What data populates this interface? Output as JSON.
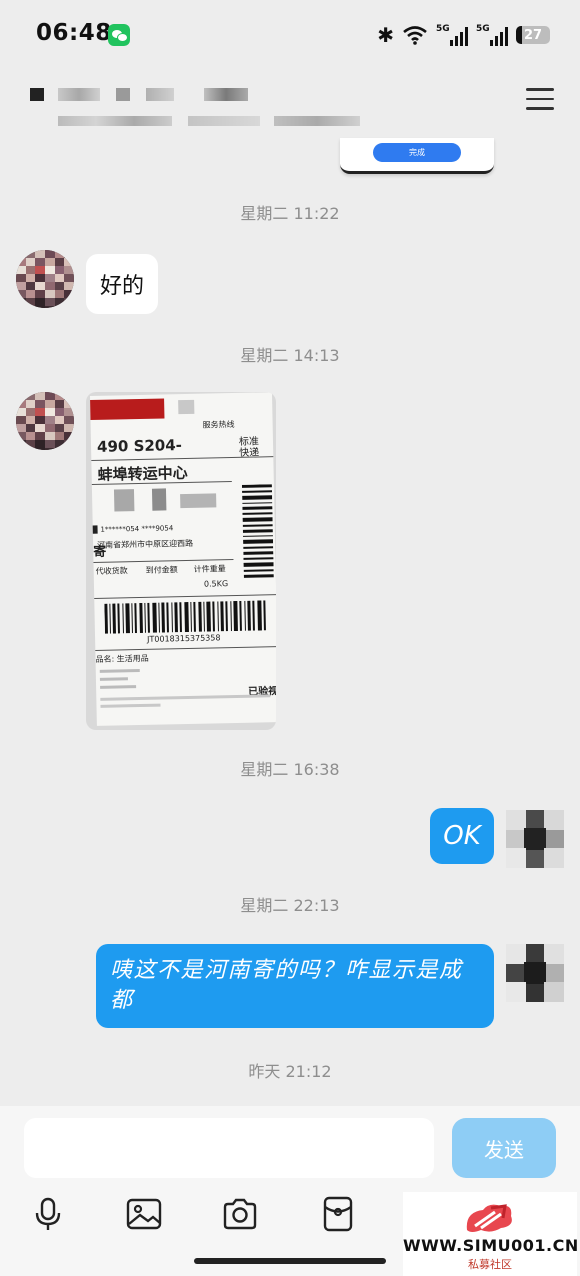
{
  "status_bar": {
    "time": "06:48",
    "battery": "27",
    "network_a": "5G",
    "network_b": "5G"
  },
  "overlay": {
    "button_label": "完成"
  },
  "messages": {
    "ts1": "星期二 11:22",
    "reply1": "好的",
    "ts2": "星期二 14:13",
    "ts3": "星期二 16:38",
    "ok": "OK",
    "ts4": "星期二 22:13",
    "long_line1": "咦这不是河南寄的吗？咋显示是成",
    "long_line2": "都",
    "ts5": "昨天 21:12"
  },
  "label_photo": {
    "number": "490   S204-",
    "center": "蚌埠转运中心",
    "std1": "标准",
    "std2": "快递",
    "hotline": "服务热线",
    "address": "河南省郑州市中原区迎西路",
    "cod": "代收货款",
    "pay": "到付金额",
    "weight_h": "计件重量",
    "weight": "0.5KG",
    "tracking": "JT0018315375358",
    "goods": "品名: 生活用品",
    "checked": "已验视",
    "sender": "寄"
  },
  "composer": {
    "placeholder": "",
    "send_label": "发送"
  },
  "watermark": {
    "site": "WWW.SIMU001.CN",
    "sub": "私募社区"
  },
  "colors": {
    "background": "#ededed",
    "bubble_blue": "#1e9bf0",
    "send_disabled": "#8ecdf5"
  }
}
